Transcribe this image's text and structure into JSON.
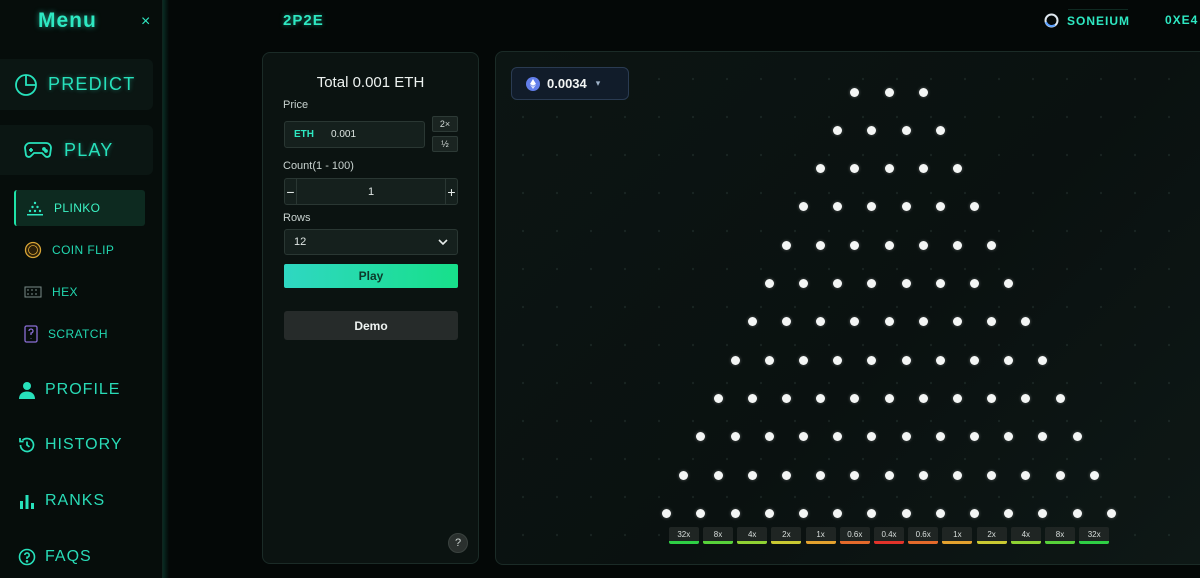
{
  "sidebar": {
    "menu_title": "Menu",
    "close_glyph": "×",
    "predict_label": "PREDICT",
    "play_label": "PLAY",
    "games": [
      {
        "label": "PLINKO",
        "icon": "plinko-icon",
        "active": true
      },
      {
        "label": "COIN FLIP",
        "icon": "coin-icon",
        "active": false
      },
      {
        "label": "HEX",
        "icon": "hex-icon",
        "active": false
      },
      {
        "label": "SCRATCH",
        "icon": "scratch-icon",
        "active": false
      }
    ],
    "profile_label": "PROFILE",
    "history_label": "HISTORY",
    "ranks_label": "RANKS",
    "faqs_label": "FAQS"
  },
  "header": {
    "brand": "2P2E",
    "network": "SONEIUM",
    "wallet": "0XE4"
  },
  "bet_panel": {
    "total": "Total 0.001 ETH",
    "price_label": "Price",
    "price_currency": "ETH",
    "price_value": "0.001",
    "double_label": "2×",
    "half_label": "½",
    "count_label": "Count(1 - 100)",
    "count_minus": "−",
    "count_value": "1",
    "count_plus": "+",
    "rows_label": "Rows",
    "rows_value": "12",
    "play_label": "Play",
    "demo_label": "Demo",
    "help_label": "?"
  },
  "board": {
    "balance": "0.0034",
    "rows": 12,
    "buckets": [
      "32x",
      "8x",
      "4x",
      "2x",
      "1x",
      "0.6x",
      "0.4x",
      "0.6x",
      "1x",
      "2x",
      "4x",
      "8x",
      "32x"
    ],
    "bucket_colors": [
      "#2ecf45",
      "#57d23a",
      "#8fd233",
      "#c9c932",
      "#e3a12e",
      "#e46a2b",
      "#e2332a",
      "#e46a2b",
      "#e3a12e",
      "#c9c932",
      "#8fd233",
      "#57d23a",
      "#2ecf45"
    ]
  },
  "colors": {
    "accent": "#2ee8c2",
    "play_gradient_start": "#2fd7c2",
    "play_gradient_end": "#17e08a"
  }
}
